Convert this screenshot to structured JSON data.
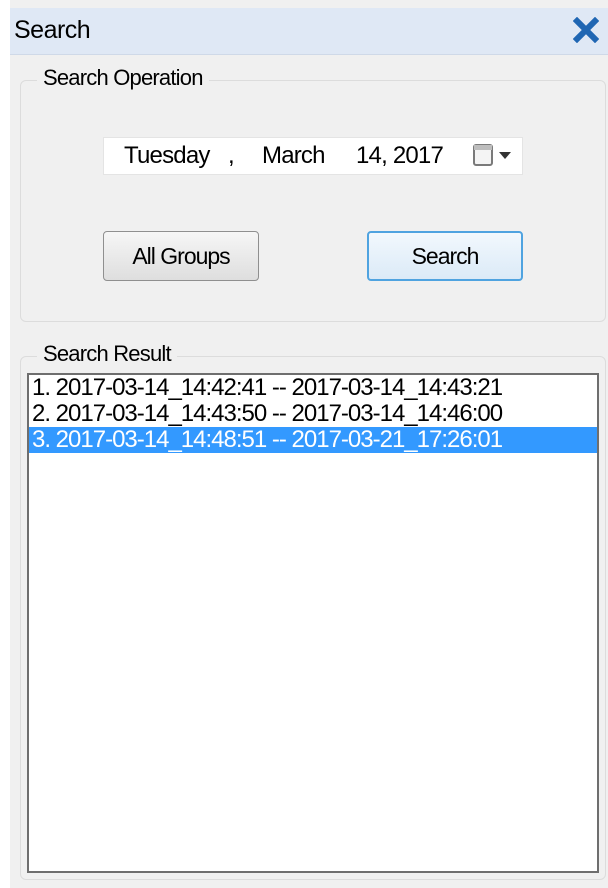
{
  "window": {
    "title": "Search"
  },
  "icons": {
    "close": "close-icon",
    "calendar": "calendar-icon",
    "dropdown": "chevron-down-icon"
  },
  "colors": {
    "titlebar": "#dfe8f5",
    "close_icon": "#1f66b3",
    "selection": "#3399ff",
    "default_button_border": "#4fa3e0"
  },
  "search_operation": {
    "legend": "Search Operation",
    "date": {
      "weekday": "Tuesday",
      "separator": ",",
      "month": "March",
      "day_year": "14, 2017"
    },
    "all_groups_label": "All Groups",
    "search_label": "Search"
  },
  "search_result": {
    "legend": "Search Result",
    "items": [
      {
        "text": "1. 2017-03-14_14:42:41 -- 2017-03-14_14:43:21",
        "selected": false
      },
      {
        "text": "2. 2017-03-14_14:43:50 -- 2017-03-14_14:46:00",
        "selected": false
      },
      {
        "text": "3. 2017-03-14_14:48:51 -- 2017-03-21_17:26:01",
        "selected": true
      }
    ]
  }
}
